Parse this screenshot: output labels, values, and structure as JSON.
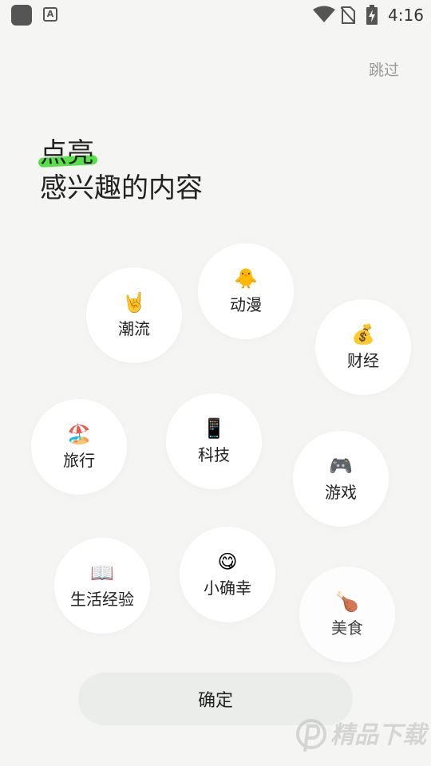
{
  "status_bar": {
    "time": "4:16",
    "notification_icon": "A"
  },
  "header": {
    "skip_label": "跳过"
  },
  "title": {
    "line1": "点亮",
    "line2": "感兴趣的内容",
    "highlight_color": "#58e04a"
  },
  "topics": [
    {
      "emoji": "🤘",
      "label": "潮流"
    },
    {
      "emoji": "🐥",
      "label": "动漫"
    },
    {
      "emoji": "💰",
      "label": "财经"
    },
    {
      "emoji": "🏖️",
      "label": "旅行"
    },
    {
      "emoji": "📱",
      "label": "科技"
    },
    {
      "emoji": "🎮",
      "label": "游戏"
    },
    {
      "emoji": "📖",
      "label": "生活经验"
    },
    {
      "emoji": "😋",
      "label": "小确幸"
    },
    {
      "emoji": "🍗",
      "label": "美食"
    }
  ],
  "footer": {
    "confirm_label": "确定"
  },
  "watermark": {
    "text": "精品下载"
  }
}
